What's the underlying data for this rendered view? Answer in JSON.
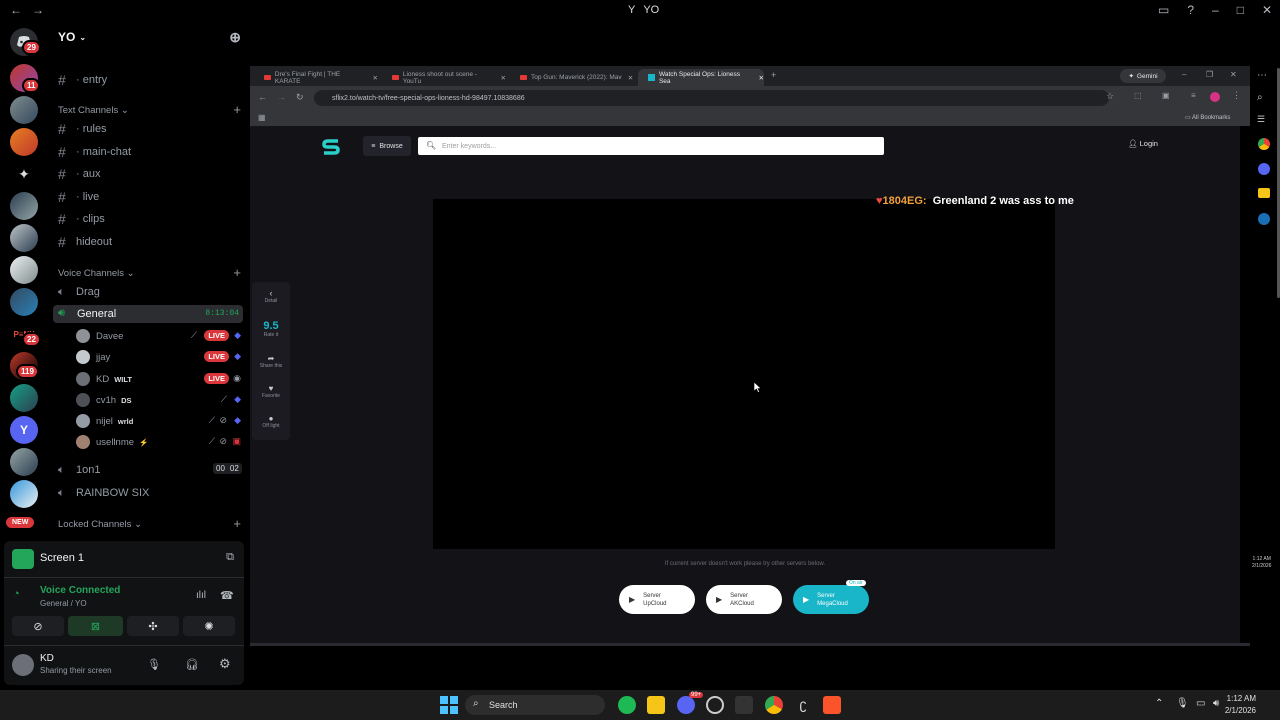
{
  "window": {
    "title": "YO",
    "nav_back": "←",
    "nav_fwd": "→"
  },
  "servers": {
    "badges": [
      "29",
      "11",
      "22",
      "119"
    ],
    "new_label": "NEW"
  },
  "guild": {
    "name": "YO",
    "channels_top": [
      {
        "label": "· entry"
      }
    ],
    "text_category": "Text Channels",
    "text_channels": [
      {
        "label": "· rules"
      },
      {
        "label": "· main-chat"
      },
      {
        "label": "· aux"
      },
      {
        "label": "· live"
      },
      {
        "label": "· clips"
      },
      {
        "label": "hideout"
      }
    ],
    "voice_category": "Voice Channels",
    "voice_channels": {
      "drag": "Drag",
      "general": "General",
      "general_time": "8:13:04",
      "one_on_one": "1on1",
      "one_on_one_counts": [
        "00",
        "02"
      ],
      "rainbow": "RAINBOW SIX"
    },
    "voice_users": [
      {
        "name": "Davee",
        "live": "LIVE",
        "tag": ""
      },
      {
        "name": "jjay",
        "live": "LIVE",
        "tag": ""
      },
      {
        "name": "KD",
        "live": "LIVE",
        "tag": "WILT"
      },
      {
        "name": "cv1h",
        "live": "",
        "tag": "DS"
      },
      {
        "name": "nijel",
        "live": "",
        "tag": "wrld"
      },
      {
        "name": "usellnme",
        "live": "",
        "tag": "⚡"
      }
    ],
    "locked_category": "Locked Channels"
  },
  "screen_panel": {
    "title": "Screen 1",
    "voice_status": "Voice Connected",
    "voice_location": "General / YO",
    "user_name": "KD",
    "user_status": "Sharing their screen"
  },
  "browser": {
    "tabs": [
      {
        "label": "Dre's Final Fight | THE KARATE "
      },
      {
        "label": "Lioness shoot out scene - YouTu"
      },
      {
        "label": "Top Gun: Maverick (2022): Mav"
      },
      {
        "label": "Watch Special Ops: Lioness Sea"
      }
    ],
    "gemini": "Gemini",
    "url": "sflix2.to/watch-tv/free-special-ops-lioness-hd-98497.10838686",
    "all_bookmarks": "All Bookmarks"
  },
  "site": {
    "browse": "Browse",
    "search_placeholder": "Enter keywords...",
    "login": "Login",
    "side_buttons": {
      "detail": "Detail",
      "rating": "9.5",
      "rate_it": "Rate it",
      "share": "Share this",
      "favorite": "Favorite",
      "offlight": "Off light"
    },
    "servers_note": "If current server doesn't work please try other servers below.",
    "server_buttons": [
      {
        "line1": "Server",
        "line2": "UpCloud"
      },
      {
        "line1": "Server",
        "line2": "AKCloud"
      },
      {
        "line1": "Server",
        "line2": "MegaCloud"
      }
    ],
    "on_air": "On air"
  },
  "overlay": {
    "name": "1804EG:",
    "message": "Greenland 2 was ass to me"
  },
  "taskbar": {
    "search": "Search",
    "time": "1:12 AM",
    "date": "2/1/2026",
    "discord_badge": "99+"
  },
  "colors": {
    "accent_green": "#23a55a",
    "live_red": "#da373c",
    "server_cyan": "#19b6c9",
    "overlay_orange": "#f0a13c"
  }
}
